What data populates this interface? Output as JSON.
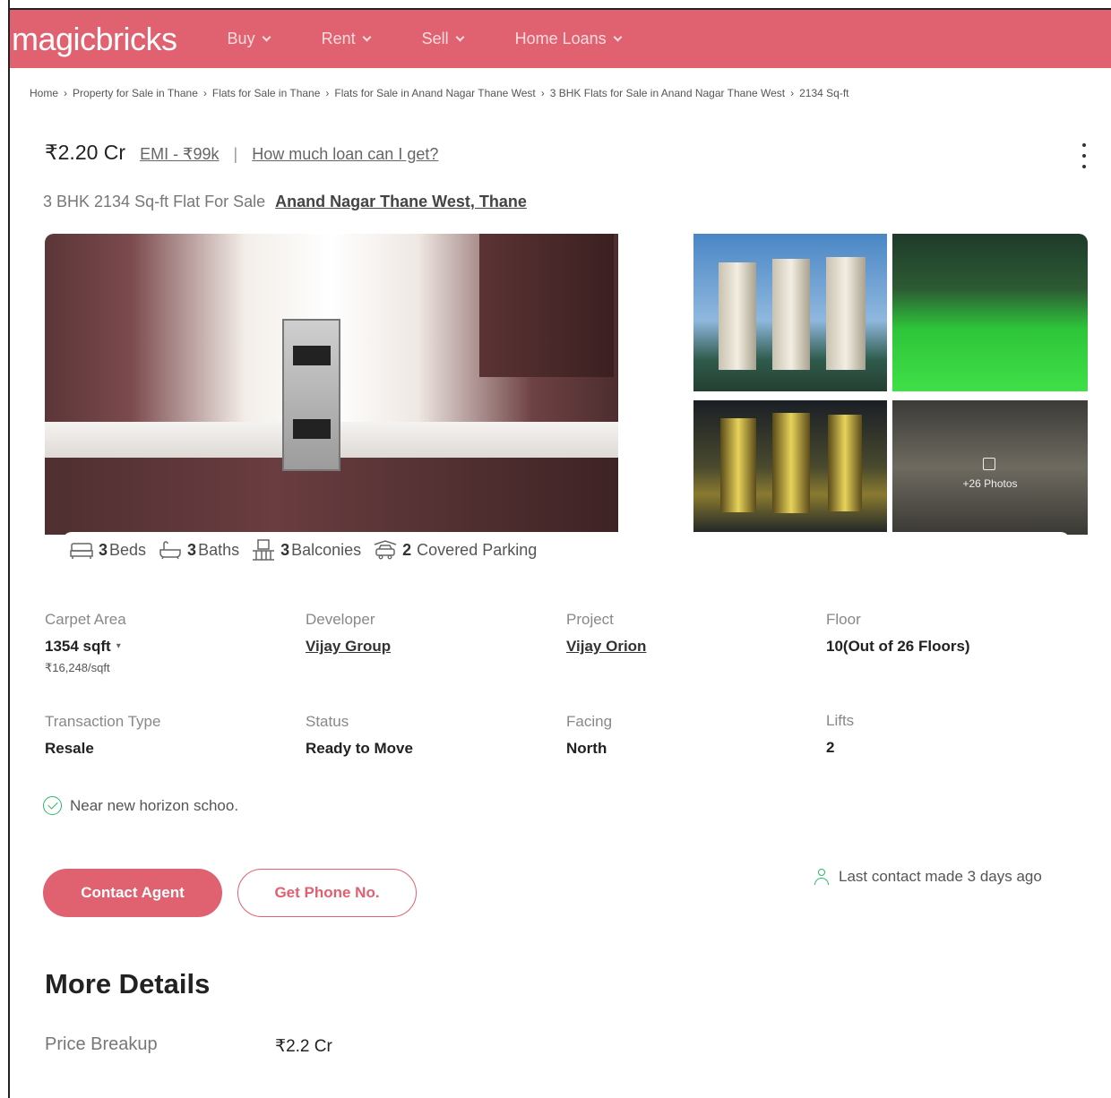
{
  "brand": {
    "logo_text": "magicbricks",
    "color": "#e0616f"
  },
  "nav": {
    "items": [
      {
        "label": "Buy"
      },
      {
        "label": "Rent"
      },
      {
        "label": "Sell"
      },
      {
        "label": "Home Loans"
      }
    ]
  },
  "breadcrumb": [
    "Home",
    "Property for Sale in Thane",
    "Flats for Sale in Thane",
    "Flats for Sale in Anand Nagar Thane West",
    "3 BHK Flats for Sale in Anand Nagar Thane West",
    "2134 Sq-ft"
  ],
  "listing": {
    "price": "₹2.20 Cr",
    "emi": "EMI - ₹99k",
    "loan_link": "How much loan can I get?",
    "subtitle": "3 BHK 2134 Sq-ft Flat For Sale",
    "location": "Anand Nagar Thane West, Thane"
  },
  "gallery": {
    "more_photos": "+26 Photos"
  },
  "amenities": {
    "beds_count": "3",
    "beds_label": "Beds",
    "baths_count": "3",
    "baths_label": "Baths",
    "balconies_count": "3",
    "balconies_label": "Balconies",
    "parking_count": "2",
    "parking_label": "Covered Parking"
  },
  "specs": {
    "carpet_area": {
      "label": "Carpet Area",
      "value": "1354 sqft",
      "sub": "₹16,248/sqft"
    },
    "developer": {
      "label": "Developer",
      "value": "Vijay Group"
    },
    "project": {
      "label": "Project",
      "value": "Vijay Orion"
    },
    "floor": {
      "label": "Floor",
      "value": "10(Out of 26 Floors)"
    },
    "transaction": {
      "label": "Transaction Type",
      "value": "Resale"
    },
    "status": {
      "label": "Status",
      "value": "Ready to Move"
    },
    "facing": {
      "label": "Facing",
      "value": "North"
    },
    "lifts": {
      "label": "Lifts",
      "value": "2"
    }
  },
  "highlight": "Near new horizon schoo.",
  "actions": {
    "contact_agent": "Contact Agent",
    "get_phone": "Get Phone No.",
    "last_contact": "Last contact made 3 days ago"
  },
  "more_details": {
    "title": "More Details",
    "price_breakup_label": "Price Breakup",
    "price_breakup_value": "₹2.2 Cr"
  }
}
